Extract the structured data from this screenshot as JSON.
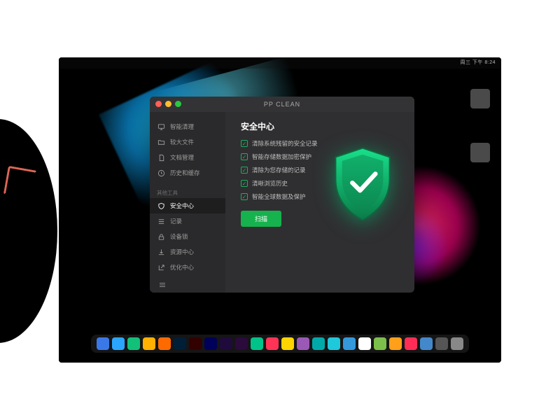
{
  "app": {
    "title": "PP CLEAN",
    "sidebar": {
      "items": [
        {
          "label": "智能清理",
          "icon": "monitor-icon"
        },
        {
          "label": "较大文件",
          "icon": "folder-icon"
        },
        {
          "label": "文档管理",
          "icon": "document-icon"
        },
        {
          "label": "历史和缓存",
          "icon": "history-icon"
        }
      ],
      "tools_heading": "其他工具",
      "tools": [
        {
          "label": "安全中心",
          "icon": "shield-icon",
          "active": true
        },
        {
          "label": "记录",
          "icon": "list-icon"
        },
        {
          "label": "设备锁",
          "icon": "lock-icon"
        },
        {
          "label": "资源中心",
          "icon": "download-icon"
        },
        {
          "label": "优化中心",
          "icon": "external-icon"
        }
      ]
    },
    "main": {
      "heading": "安全中心",
      "checks": [
        "清除系统残留的安全记录",
        "智能存储数据加密保护",
        "清除为您存储的记录",
        "清晰浏览历史",
        "智能全球数据及保护"
      ],
      "scan_label": "扫描"
    }
  },
  "menubar": {
    "right_text": "周三 下午 8:24"
  },
  "dock_colors": [
    "#3b78e7",
    "#2aa6ff",
    "#13c07a",
    "#ffb000",
    "#ff6a00",
    "#001e36",
    "#330000",
    "#00005b",
    "#1f0a3c",
    "#2b0a3c",
    "#00c389",
    "#ff3355",
    "#ffd400",
    "#9b59b6",
    "#0aa",
    "#1fc8db",
    "#3498db",
    "#ffffff",
    "#7cc04b",
    "#ff9f1a",
    "#ff2d55",
    "#48c",
    "#555",
    "#888"
  ]
}
